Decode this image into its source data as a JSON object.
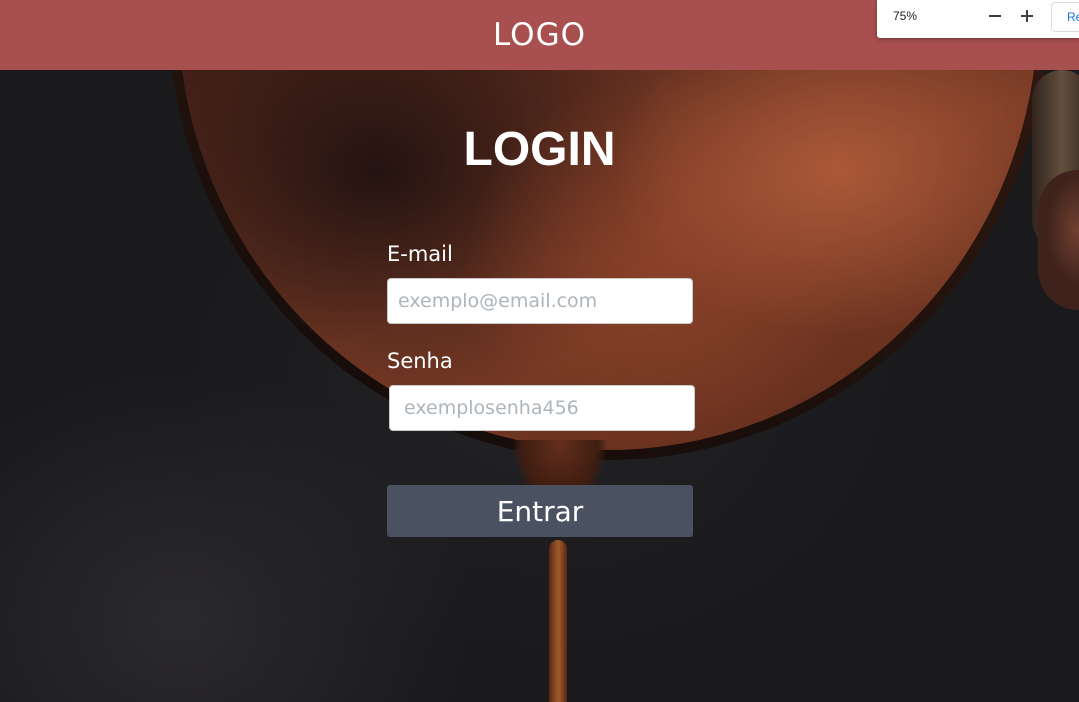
{
  "header": {
    "logo": "LOGO",
    "background_color": "#a84f4f"
  },
  "zoom_popup": {
    "level": "75%",
    "minus_icon": "minus-icon",
    "plus_icon": "plus-icon",
    "reset_label": "Re"
  },
  "login": {
    "title": "LOGIN",
    "email_label": "E-mail",
    "email_placeholder": "exemplo@email.com",
    "email_value": "",
    "password_label": "Senha",
    "password_placeholder": "exemplosenha456",
    "password_value": "",
    "submit_label": "Entrar",
    "submit_color": "#4a5261"
  }
}
